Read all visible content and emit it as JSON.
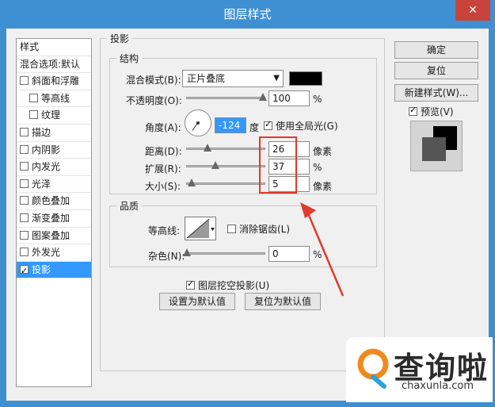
{
  "window": {
    "title": "图层样式",
    "close_glyph": "✕"
  },
  "style_list": [
    {
      "label": "样式",
      "checkbox": false,
      "indent": false,
      "selected": false
    },
    {
      "label": "混合选项:默认",
      "checkbox": false,
      "indent": false,
      "selected": false
    },
    {
      "label": "斜面和浮雕",
      "checkbox": true,
      "checked": false,
      "indent": false,
      "selected": false
    },
    {
      "label": "等高线",
      "checkbox": true,
      "checked": false,
      "indent": true,
      "selected": false
    },
    {
      "label": "纹理",
      "checkbox": true,
      "checked": false,
      "indent": true,
      "selected": false
    },
    {
      "label": "描边",
      "checkbox": true,
      "checked": false,
      "indent": false,
      "selected": false
    },
    {
      "label": "内阴影",
      "checkbox": true,
      "checked": false,
      "indent": false,
      "selected": false
    },
    {
      "label": "内发光",
      "checkbox": true,
      "checked": false,
      "indent": false,
      "selected": false
    },
    {
      "label": "光泽",
      "checkbox": true,
      "checked": false,
      "indent": false,
      "selected": false
    },
    {
      "label": "颜色叠加",
      "checkbox": true,
      "checked": false,
      "indent": false,
      "selected": false
    },
    {
      "label": "渐变叠加",
      "checkbox": true,
      "checked": false,
      "indent": false,
      "selected": false
    },
    {
      "label": "图案叠加",
      "checkbox": true,
      "checked": false,
      "indent": false,
      "selected": false
    },
    {
      "label": "外发光",
      "checkbox": true,
      "checked": false,
      "indent": false,
      "selected": false
    },
    {
      "label": "投影",
      "checkbox": true,
      "checked": true,
      "indent": false,
      "selected": true
    }
  ],
  "panel": {
    "section_title": "投影",
    "structure": {
      "title": "结构",
      "blend_mode_label": "混合模式(B):",
      "blend_mode_value": "正片叠底",
      "blend_color": "#000000",
      "opacity_label": "不透明度(O):",
      "opacity_value": "100",
      "opacity_unit": "%",
      "angle_label": "角度(A):",
      "angle_value": "-124",
      "angle_unit": "度",
      "global_light_label": "使用全局光(G)",
      "global_light_checked": true,
      "distance_label": "距离(D):",
      "distance_value": "26",
      "distance_unit": "像素",
      "spread_label": "扩展(R):",
      "spread_value": "37",
      "spread_unit": "%",
      "size_label": "大小(S):",
      "size_value": "5",
      "size_unit": "像素"
    },
    "quality": {
      "title": "品质",
      "contour_label": "等高线:",
      "antialias_label": "消除锯齿(L)",
      "antialias_checked": false,
      "noise_label": "杂色(N):",
      "noise_value": "0",
      "noise_unit": "%"
    },
    "knockout_label": "图层挖空投影(U)",
    "knockout_checked": true,
    "make_default_label": "设置为默认值",
    "reset_default_label": "复位为默认值"
  },
  "right": {
    "ok_label": "确定",
    "reset_label": "复位",
    "new_style_label": "新建样式(W)...",
    "preview_label": "预览(V)",
    "preview_checked": true
  },
  "watermark": {
    "text": "查询啦",
    "url": "chaxunla.com"
  },
  "colors": {
    "titlebar": "#3f90d2",
    "selection": "#3399ff",
    "highlight": "#e03a2e"
  }
}
